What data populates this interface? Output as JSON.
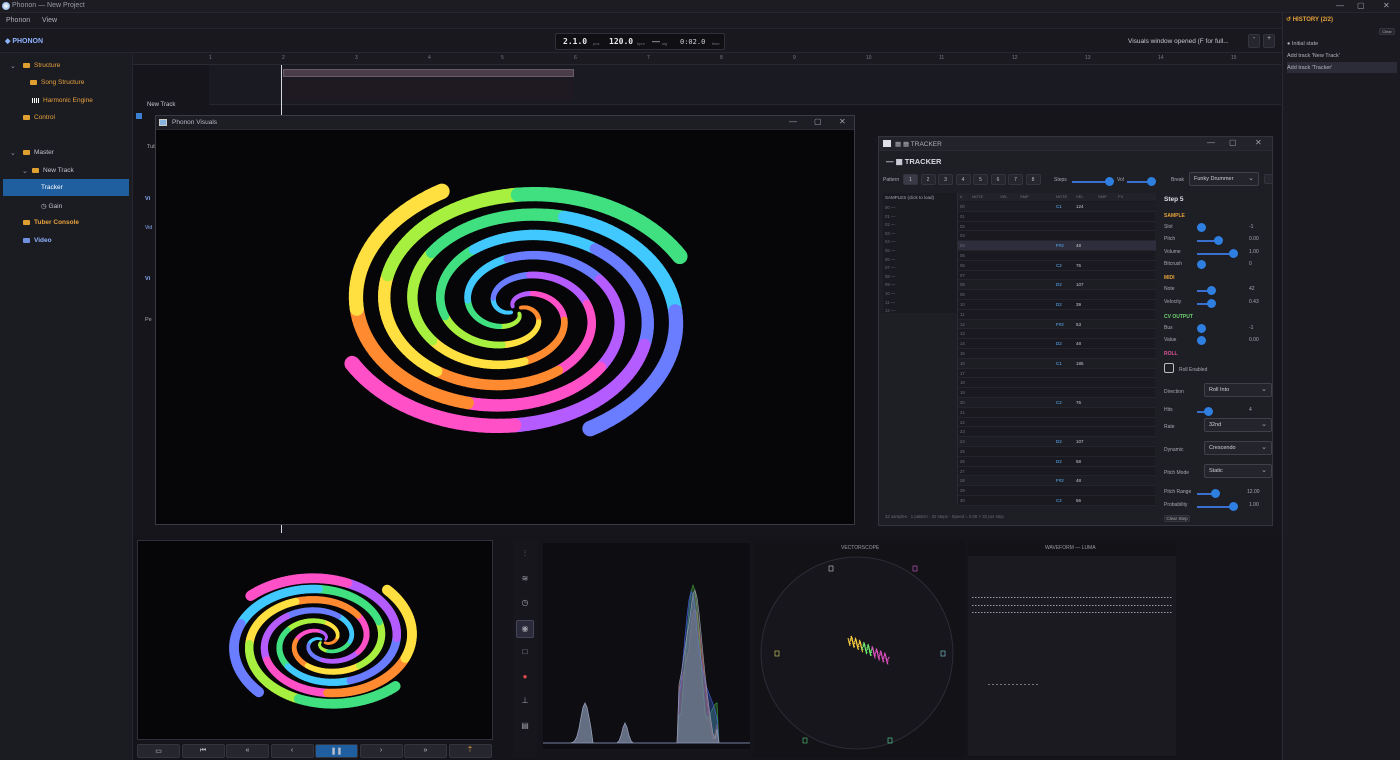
{
  "window": {
    "title": "Phonon — New Project"
  },
  "menu": {
    "items": [
      "Phonon",
      "View"
    ]
  },
  "app": {
    "brand": "◆ PHONON"
  },
  "transport": {
    "position": "2.1.0",
    "position_unit": "pos",
    "tempo": "120.0",
    "tempo_unit": "bpm",
    "sig": "—",
    "sig_unit": "sig",
    "time": "0:02.0",
    "time_unit": "time"
  },
  "status": {
    "message": "Visuals window opened (F for full..."
  },
  "sidebar": {
    "items": [
      {
        "label": "Structure"
      },
      {
        "label": "Song Structure"
      },
      {
        "label": "Harmonic Engine"
      },
      {
        "label": "Control"
      },
      {
        "label": "Master"
      },
      {
        "label": "New Track"
      },
      {
        "label": "Tracker"
      },
      {
        "label": "Gain"
      },
      {
        "label": "Tuber Console"
      },
      {
        "label": "Video"
      }
    ]
  },
  "timeline": {
    "ruler": [
      "1",
      "2",
      "3",
      "4",
      "5",
      "6",
      "7",
      "8",
      "9",
      "10",
      "11",
      "12",
      "13",
      "14",
      "15"
    ],
    "track_name": "New Track",
    "partial_labels": [
      "Tub",
      "Vi",
      "Vid",
      "Vi",
      "Pe"
    ]
  },
  "history": {
    "title": "HISTORY (2/2)",
    "clear": "Clear",
    "items": [
      "Initial state",
      "Add track 'New Track'",
      "Add track 'Tracker'"
    ]
  },
  "visuals": {
    "title": "Phonon Visuals"
  },
  "tracker": {
    "win_title": "TRACKER",
    "header": "TRACKER",
    "pattern_label": "Pattern",
    "patterns": [
      "1",
      "2",
      "3",
      "4",
      "5",
      "6",
      "7",
      "8"
    ],
    "steps_label": "Steps",
    "vol_label": "Vol",
    "break_label": "Break",
    "break_value": "Funky Drummer",
    "samples_header": "SAMPLES (click to load)",
    "sample_slots": [
      "00",
      "01",
      "02",
      "03",
      "04",
      "05",
      "06",
      "07",
      "08",
      "09",
      "10",
      "11",
      "12"
    ],
    "col_headers": [
      "#",
      "NOTE",
      "VEL",
      "SMP",
      "",
      "NOTE",
      "VEL",
      "SMP",
      "FX"
    ],
    "rows": [
      {
        "n": "00",
        "note": "C1",
        "vel": "124"
      },
      {
        "n": "01",
        "note": "",
        "vel": ""
      },
      {
        "n": "02",
        "note": "",
        "vel": ""
      },
      {
        "n": "03",
        "note": "",
        "vel": ""
      },
      {
        "n": "04",
        "note": "F#2",
        "vel": "48"
      },
      {
        "n": "05",
        "note": "",
        "vel": ""
      },
      {
        "n": "06",
        "note": "C2",
        "vel": "76"
      },
      {
        "n": "07",
        "note": "",
        "vel": ""
      },
      {
        "n": "08",
        "note": "D2",
        "vel": "107"
      },
      {
        "n": "09",
        "note": "",
        "vel": ""
      },
      {
        "n": "10",
        "note": "D2",
        "vel": "39"
      },
      {
        "n": "11",
        "note": "",
        "vel": ""
      },
      {
        "n": "12",
        "note": "F#2",
        "vel": "53"
      },
      {
        "n": "13",
        "note": "",
        "vel": ""
      },
      {
        "n": "14",
        "note": "D2",
        "vel": "48"
      },
      {
        "n": "15",
        "note": "",
        "vel": ""
      },
      {
        "n": "16",
        "note": "C1",
        "vel": "185"
      },
      {
        "n": "17",
        "note": "",
        "vel": ""
      },
      {
        "n": "18",
        "note": "",
        "vel": ""
      },
      {
        "n": "19",
        "note": "",
        "vel": ""
      },
      {
        "n": "20",
        "note": "C2",
        "vel": "76"
      },
      {
        "n": "21",
        "note": "",
        "vel": ""
      },
      {
        "n": "22",
        "note": "",
        "vel": ""
      },
      {
        "n": "23",
        "note": "",
        "vel": ""
      },
      {
        "n": "24",
        "note": "D2",
        "vel": "107"
      },
      {
        "n": "25",
        "note": "",
        "vel": ""
      },
      {
        "n": "26",
        "note": "D2",
        "vel": "58"
      },
      {
        "n": "27",
        "note": "",
        "vel": ""
      },
      {
        "n": "28",
        "note": "F#2",
        "vel": "48"
      },
      {
        "n": "29",
        "note": "",
        "vel": ""
      },
      {
        "n": "30",
        "note": "C2",
        "vel": "56"
      }
    ],
    "footer": "32 samples · 1 pattern · 32 steps · Speed = 0.00 × 32 per step",
    "step": {
      "title": "Step 5",
      "sample_head": "SAMPLE",
      "slot_label": "Slot",
      "slot_value": "-1",
      "pitch_label": "Pitch",
      "pitch_value": "0.00",
      "volume_label": "Volume",
      "volume_value": "1.00",
      "bitcrush_label": "Bitcrush",
      "bitcrush_value": "0",
      "midi_head": "MIDI",
      "note_label": "Note",
      "note_value": "42",
      "velocity_label": "Velocity",
      "velocity_value": "0.43",
      "cv_head": "CV OUTPUT",
      "bus_label": "Bus",
      "bus_value": "-1",
      "value_label": "Value",
      "value_value": "0.00",
      "roll_head": "ROLL",
      "roll_enabled": "Roll Enabled",
      "direction_label": "Direction",
      "direction_value": "Roll Into",
      "hits_label": "Hits",
      "hits_value": "4",
      "rate_label": "Rate",
      "rate_value": "32nd",
      "dynamic_label": "Dynamic",
      "dynamic_value": "Crescendo",
      "pitchmode_label": "Pitch Mode",
      "pitchmode_value": "Static",
      "pitchrange_label": "Pitch Range",
      "pitchrange_value": "12.00",
      "probability_label": "Probability",
      "probability_value": "1.00",
      "clear_label": "Clear Step"
    }
  },
  "scopes": {
    "vectorscope": "VECTORSCOPE",
    "waveform": "WAVEFORM — LUMA"
  },
  "colors": {
    "accent": "#2e7fe0",
    "selected": "#1f5fa0",
    "orange": "#e6a23c"
  }
}
